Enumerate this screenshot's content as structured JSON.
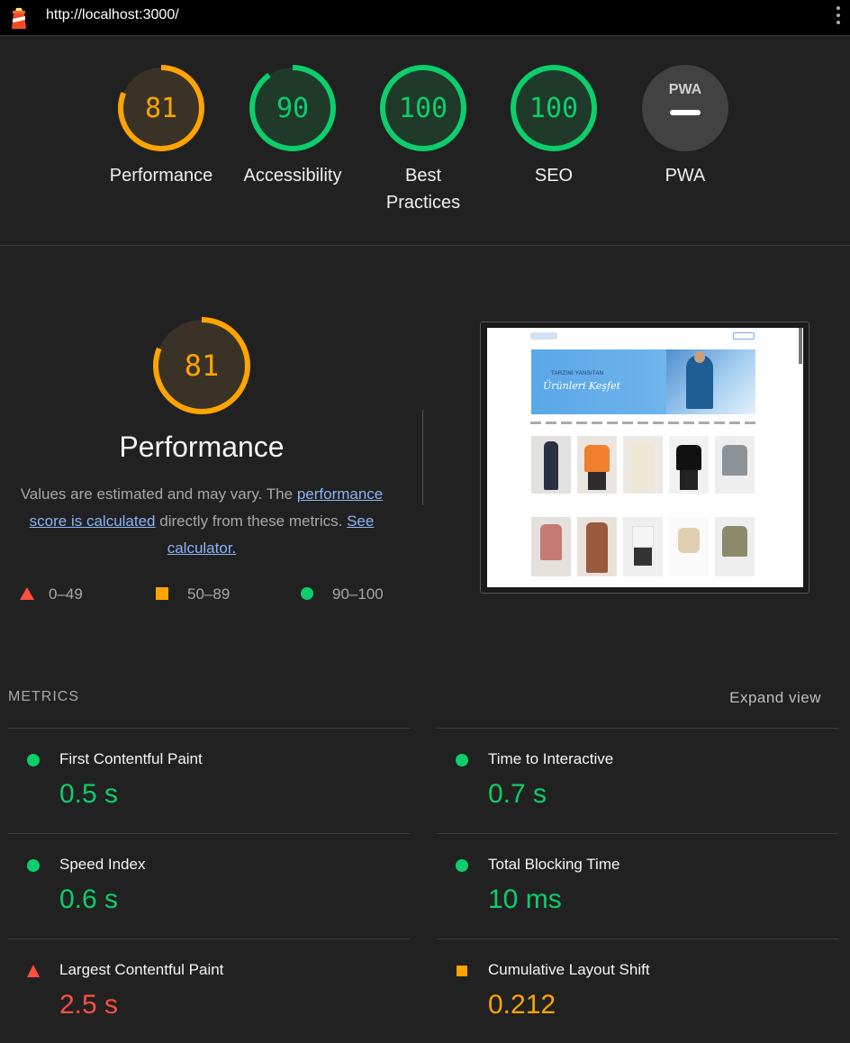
{
  "header": {
    "url": "http://localhost:3000/"
  },
  "categories": [
    {
      "id": "performance",
      "score": "81",
      "label": "Performance",
      "status": "average",
      "fraction": 0.81,
      "color": "#ffa400"
    },
    {
      "id": "accessibility",
      "score": "90",
      "label": "Accessibility",
      "status": "pass",
      "fraction": 0.9,
      "color": "#0cce6b"
    },
    {
      "id": "best-practices",
      "score": "100",
      "label": "Best Practices",
      "status": "pass",
      "fraction": 1.0,
      "color": "#0cce6b"
    },
    {
      "id": "seo",
      "score": "100",
      "label": "SEO",
      "status": "pass",
      "fraction": 1.0,
      "color": "#0cce6b"
    },
    {
      "id": "pwa",
      "score": "",
      "label": "PWA",
      "status": "na",
      "badge": "PWA"
    }
  ],
  "performance": {
    "score": "81",
    "title": "Performance",
    "desc_prefix": "Values are estimated and may vary. The ",
    "link1": "performance score is calculated",
    "desc_mid": " directly from these metrics. ",
    "link2": "See calculator.",
    "legend": [
      {
        "icon": "red-triangle-icon",
        "range": "0–49"
      },
      {
        "icon": "orange-square-icon",
        "range": "50–89"
      },
      {
        "icon": "green-circle-icon",
        "range": "90–100"
      }
    ]
  },
  "screenshot": {
    "banner_line1": "TARZINI YANSITAN",
    "banner_line2": "Ürünleri Keşfet"
  },
  "metrics": {
    "heading": "METRICS",
    "expand_label": "Expand view",
    "items": [
      {
        "title": "First Contentful Paint",
        "value": "0.5 s",
        "status": "pass"
      },
      {
        "title": "Time to Interactive",
        "value": "0.7 s",
        "status": "pass"
      },
      {
        "title": "Speed Index",
        "value": "0.6 s",
        "status": "pass"
      },
      {
        "title": "Total Blocking Time",
        "value": "10 ms",
        "status": "pass"
      },
      {
        "title": "Largest Contentful Paint",
        "value": "2.5 s",
        "status": "fail"
      },
      {
        "title": "Cumulative Layout Shift",
        "value": "0.212",
        "status": "average"
      }
    ]
  },
  "colors": {
    "pass": "#0cce6b",
    "average": "#ffa400",
    "fail": "#ff4e42"
  }
}
